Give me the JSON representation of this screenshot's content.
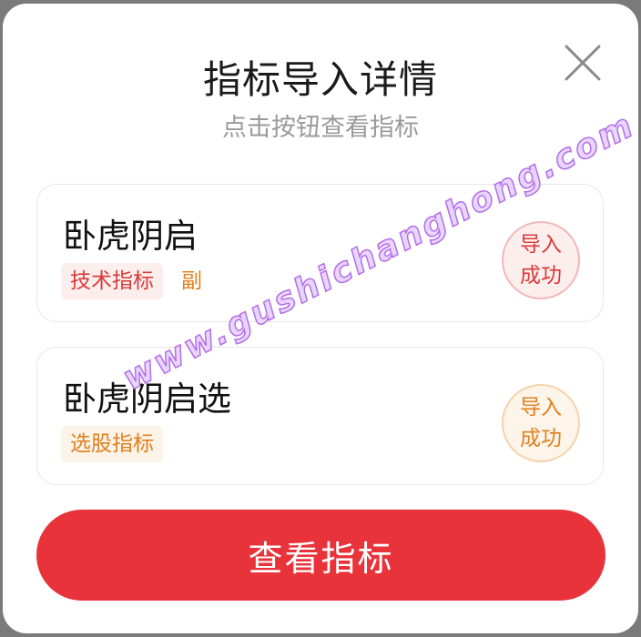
{
  "dialog": {
    "title": "指标导入详情",
    "subtitle": "点击按钮查看指标",
    "close_icon": "close-icon"
  },
  "cards": [
    {
      "name": "卧虎阴启",
      "tags": [
        "技术指标",
        "副"
      ],
      "status_line1": "导入",
      "status_line2": "成功",
      "status_color": "#d93a3a"
    },
    {
      "name": "卧虎阴启选",
      "tags": [
        "选股指标"
      ],
      "status_line1": "导入",
      "status_line2": "成功",
      "status_color": "#e0801f"
    }
  ],
  "action": {
    "view_button_label": "查看指标",
    "color": "#e8333b"
  },
  "watermark": "www.gushichanghong.com"
}
